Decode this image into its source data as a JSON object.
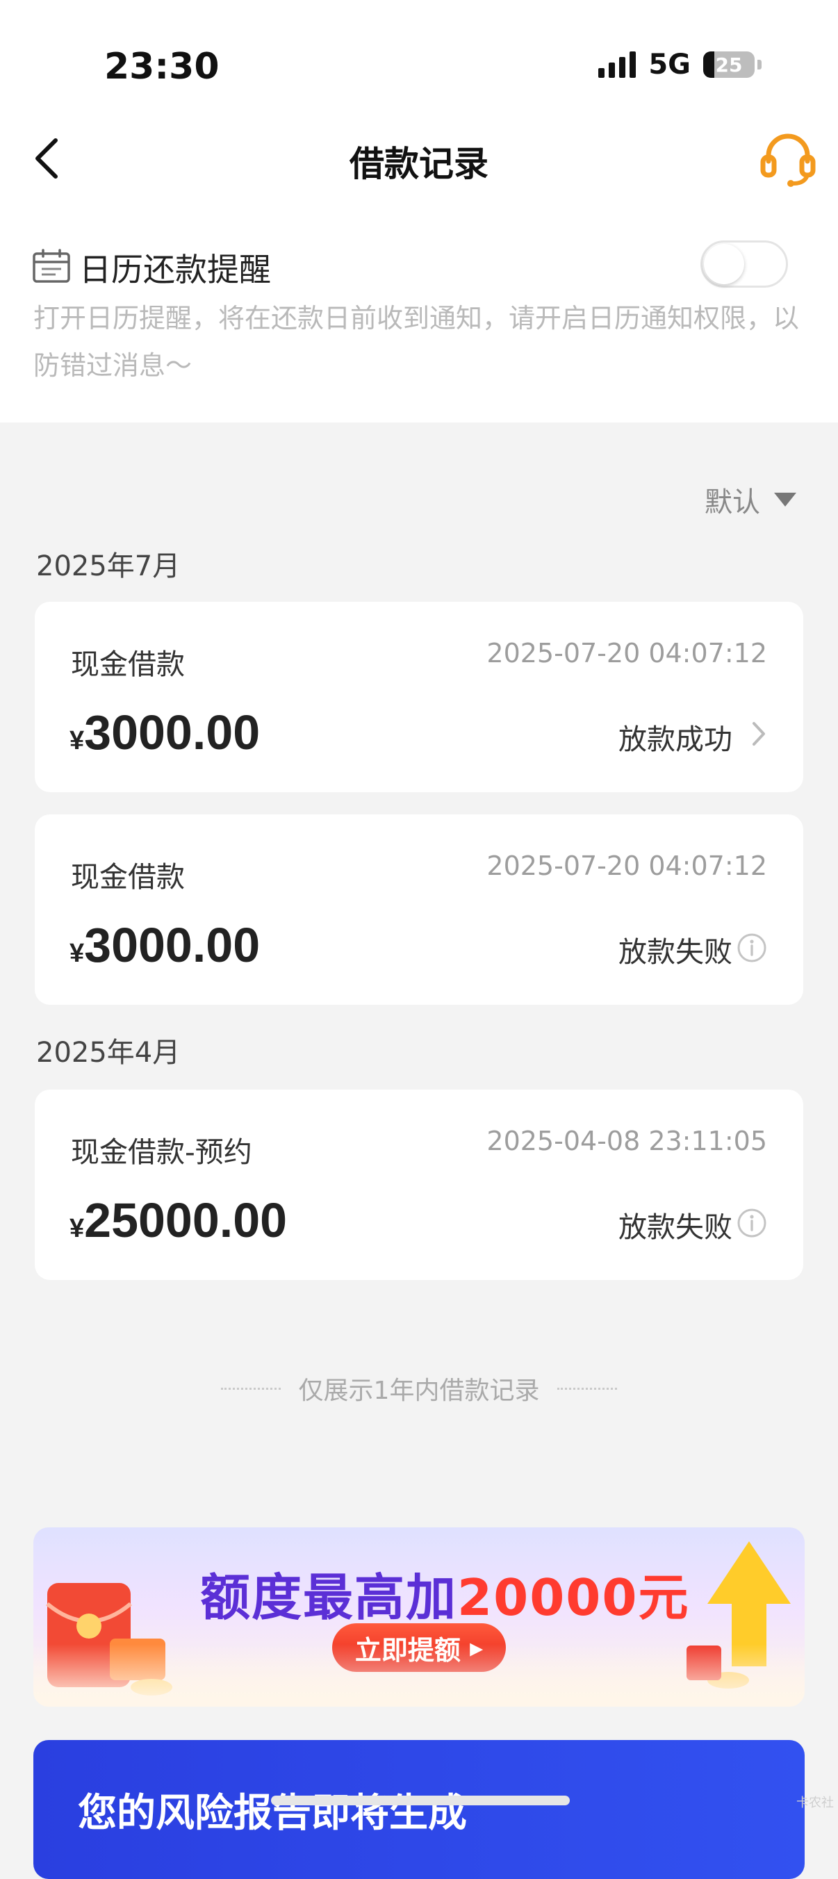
{
  "status_bar": {
    "time": "23:30",
    "network": "5G",
    "battery": "25"
  },
  "nav": {
    "title": "借款记录"
  },
  "calendar": {
    "title": "日历还款提醒",
    "description": "打开日历提醒，将在还款日前收到通知，请开启日历通知权限，以防错过消息～",
    "enabled": false
  },
  "sort": {
    "label": "默认"
  },
  "groups": [
    {
      "month": "2025年7月",
      "records": [
        {
          "name": "现金借款",
          "time": "2025-07-20 04:07:12",
          "currency": "¥",
          "amount": "3000.00",
          "status": "放款成功"
        },
        {
          "name": "现金借款",
          "time": "2025-07-20 04:07:12",
          "currency": "¥",
          "amount": "3000.00",
          "status": "放款失败"
        }
      ]
    },
    {
      "month": "2025年4月",
      "records": [
        {
          "name": "现金借款-预约",
          "time": "2025-04-08 23:11:05",
          "currency": "¥",
          "amount": "25000.00",
          "status": "放款失败"
        }
      ]
    }
  ],
  "footer_note": "仅展示1年内借款记录",
  "banner_promo": {
    "headline_prefix": "额度最高加",
    "headline_amount": "20000元",
    "cta": "立即提额"
  },
  "banner_report": {
    "headline": "您的风险报告即将生成"
  },
  "watermark": "卡农社",
  "colors": {
    "accent": "#f39a1e",
    "promo_purple": "#5b2fd6",
    "promo_red": "#ff3b2f",
    "report_blue": "#2a3fe0"
  }
}
